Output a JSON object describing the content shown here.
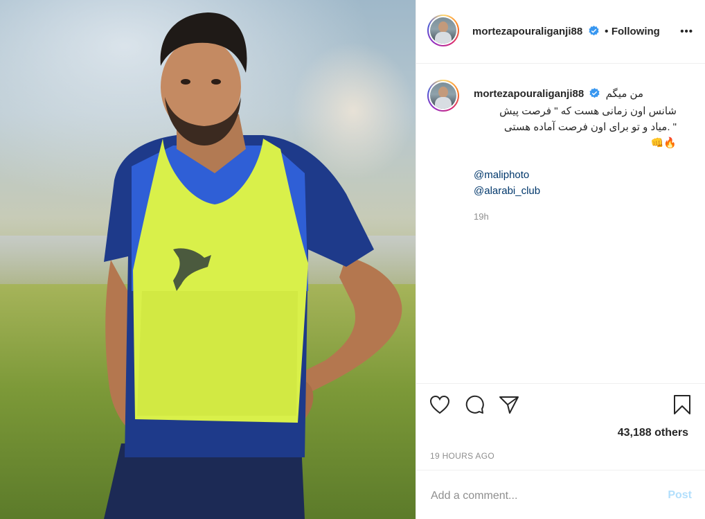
{
  "post": {
    "username": "mortezapouraliganji88",
    "follow_separator": "•",
    "follow_label": "Following",
    "more_label": "•••"
  },
  "caption": {
    "username": "mortezapouraliganji88",
    "line1": "من میگم",
    "line2": "شانس اون زمانی هست که \" فرصت پیش",
    "line3": "\" .میاد و تو برای اون فرصت آماده هستی",
    "emoji": "🔥👊",
    "mentions": [
      "@maliphoto",
      "@alarabi_club"
    ],
    "time": "19h"
  },
  "actions": {
    "like_icon": "heart-icon",
    "comment_icon": "comment-bubble-icon",
    "share_icon": "paper-plane-icon",
    "save_icon": "bookmark-icon",
    "likes_text": "43,188 others",
    "posted_time": "19 HOURS AGO"
  },
  "comment": {
    "placeholder": "Add a comment...",
    "post_label": "Post"
  },
  "colors": {
    "text": "#262626",
    "muted": "#8e8e8e",
    "link": "#00376b",
    "verified": "#3897f0",
    "post_disabled": "#b2dffc",
    "border": "#efefef"
  }
}
